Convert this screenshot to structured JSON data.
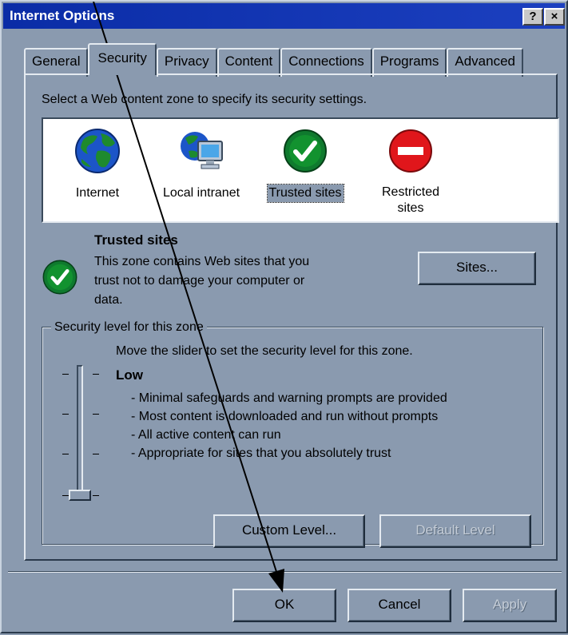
{
  "window": {
    "title": "Internet Options"
  },
  "titlebar_buttons": {
    "help": "?",
    "close": "×"
  },
  "tabs": [
    {
      "label": "General"
    },
    {
      "label": "Security"
    },
    {
      "label": "Privacy"
    },
    {
      "label": "Content"
    },
    {
      "label": "Connections"
    },
    {
      "label": "Programs"
    },
    {
      "label": "Advanced"
    }
  ],
  "instruction": "Select a Web content zone to specify its security settings.",
  "zones": [
    {
      "label": "Internet",
      "icon": "globe-icon"
    },
    {
      "label": "Local intranet",
      "icon": "intranet-icon"
    },
    {
      "label": "Trusted sites",
      "icon": "checkmark-icon"
    },
    {
      "label_line1": "Restricted",
      "label_line2": "sites",
      "icon": "no-entry-icon"
    }
  ],
  "selected_zone": {
    "title": "Trusted sites",
    "desc_line1": "This zone contains Web sites that you",
    "desc_line2": "trust not to damage your computer or",
    "desc_line3": "data."
  },
  "sites_button": "Sites...",
  "security_group": {
    "title": "Security level for this zone",
    "hint": "Move the slider to set the security level for this zone.",
    "level": "Low",
    "bullets": [
      "- Minimal safeguards and warning prompts are provided",
      "- Most content is downloaded and run without prompts",
      "- All active content can run",
      "- Appropriate for sites that you absolutely trust"
    ],
    "custom_level_button": "Custom Level...",
    "default_level_button": "Default Level"
  },
  "footer": {
    "ok": "OK",
    "cancel": "Cancel",
    "apply": "Apply"
  },
  "colors": {
    "dialog_bg": "#8a9aaf",
    "title_bar": "#0a2ca6",
    "check_green": "#0f7a2e",
    "stop_red": "#e0161b"
  }
}
